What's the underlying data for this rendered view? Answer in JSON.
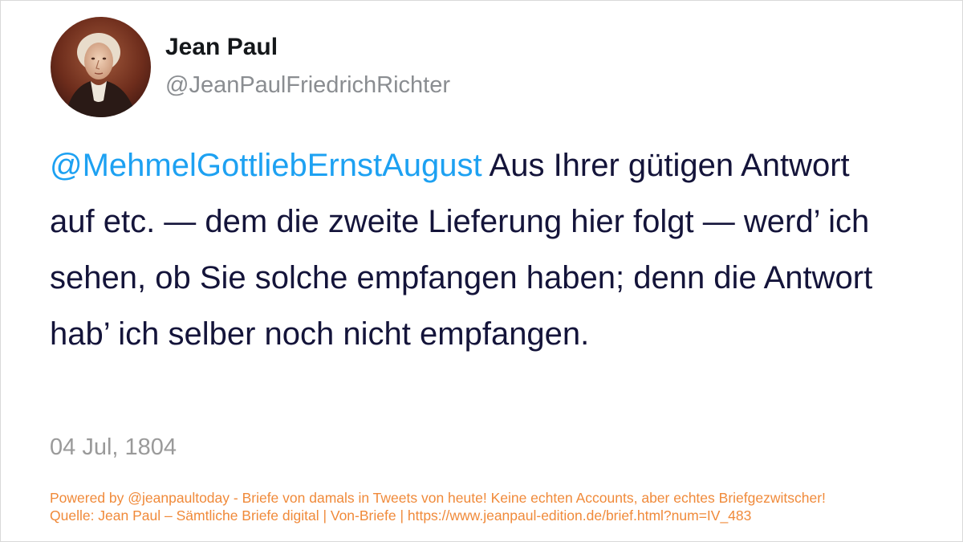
{
  "author": {
    "display_name": "Jean Paul",
    "handle": "@JeanPaulFriedrichRichter",
    "avatar_icon": "portrait-avatar"
  },
  "tweet": {
    "mention": "@MehmelGottliebErnstAugust",
    "text": " Aus Ihrer gütigen Antwort auf etc. — dem die zweite Lieferung hier folgt — werd’ ich sehen, ob Sie solche empfangen haben; denn die Antwort hab’ ich selber noch nicht empfangen.",
    "date": "04 Jul, 1804"
  },
  "footer": {
    "line1": "Powered by @jeanpaultoday - Briefe von damals in Tweets von heute! Keine echten Accounts, aber echtes Briefgezwitscher!",
    "line2": "Quelle: Jean Paul – Sämtliche Briefe digital | Von-Briefe | https://www.jeanpaul-edition.de/brief.html?num=IV_483"
  },
  "colors": {
    "mention": "#1da1f2",
    "text": "#14143a",
    "muted": "#9a9a9a",
    "footer": "#f08a3a"
  }
}
